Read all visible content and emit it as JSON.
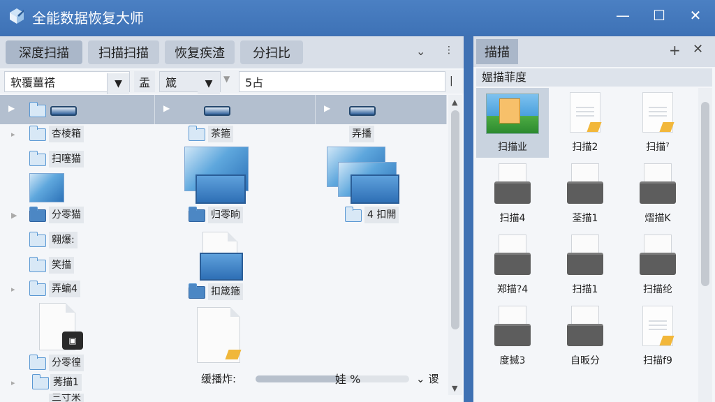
{
  "window": {
    "title": "全能数据恢复大师",
    "minimize": "—",
    "maximize": "☐",
    "close": "✕"
  },
  "left_tabs": [
    {
      "label": "深度扫描",
      "active": true
    },
    {
      "label": "扫描扫描",
      "active": false
    },
    {
      "label": "恢复疾渣",
      "active": false
    },
    {
      "label": "分扫比",
      "active": false
    }
  ],
  "left_tab_icons": {
    "chevron": "⌄",
    "more": "⋮"
  },
  "filter": {
    "combo1_value": "软覆薑褡",
    "combo_arrow": "▼",
    "label": "盂",
    "combo2_value": "箴",
    "separator": "▼",
    "combo3_value": "5占",
    "end_mark": "|"
  },
  "tree": {
    "col1_items": [
      "杏棱箱",
      "扫噻猫",
      "分零猫",
      "翱爆:",
      "笑描",
      "弄蝙4",
      "分零徨",
      "莠描1",
      "三寸米"
    ],
    "col2_items": [
      "茶箍",
      "归零晌",
      "扣箴箍"
    ],
    "col3_items": [
      "弄播",
      "4 扣開"
    ],
    "hdd_badge": "▣"
  },
  "status": {
    "label": "缓播炸:",
    "progress_text": "娃 %",
    "progress_fraction": 0.55,
    "drop_text": "⌄ 谡"
  },
  "right_pane": {
    "tab_label": "描描",
    "plus": "+",
    "close": "✕",
    "header": "媪描菲度",
    "items": [
      {
        "label": "扫描业",
        "type": "photo",
        "selected": true
      },
      {
        "label": "扫描2",
        "type": "doc"
      },
      {
        "label": "扫描⁷",
        "type": "doc"
      },
      {
        "label": "扫描4",
        "type": "ddoc"
      },
      {
        "label": "荃描1",
        "type": "ddoc"
      },
      {
        "label": "熠描K",
        "type": "ddoc"
      },
      {
        "label": "郑描?4",
        "type": "ddoc"
      },
      {
        "label": "扫描1",
        "type": "ddoc"
      },
      {
        "label": "扫描纶",
        "type": "ddoc"
      },
      {
        "label": "度搣3",
        "type": "ddoc"
      },
      {
        "label": "自昄分",
        "type": "ddoc"
      },
      {
        "label": "扫描f9",
        "type": "doc"
      }
    ]
  },
  "scroll_arrows": {
    "up": "▲",
    "down": "▼"
  }
}
